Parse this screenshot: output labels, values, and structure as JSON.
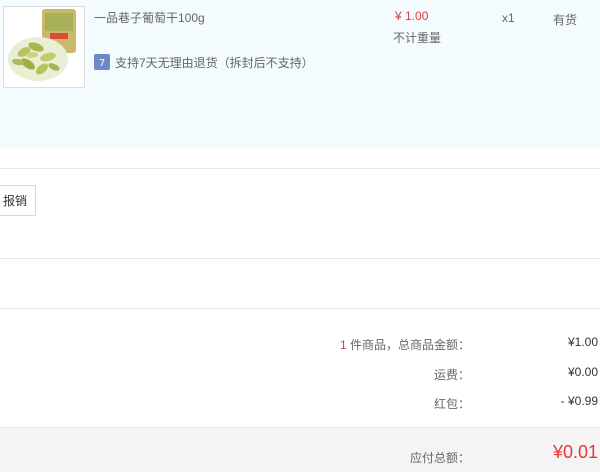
{
  "item": {
    "product_name": "一品巷子葡萄干100g",
    "price": "¥ 1.00",
    "weight_note": "不计重量",
    "quantity": "x1",
    "stock_status": "有货",
    "return_policy": "支持7天无理由退货（拆封后不支持）",
    "return_icon_glyph": "7"
  },
  "invoice": {
    "button_label": "报销"
  },
  "summary": {
    "count": "1",
    "count_suffix": " 件商品，总商品金额：",
    "subtotal": "¥1.00",
    "shipping_label": "运费：",
    "shipping": "¥0.00",
    "redpacket_label": "红包：",
    "redpacket": "- ¥0.99"
  },
  "footer": {
    "total_label": "应付总额：",
    "total": "¥0.01"
  },
  "colors": {
    "accent_red": "#e4393c",
    "panel_bg": "#f3fbfe",
    "return_icon_bg": "#6a8bc5"
  }
}
